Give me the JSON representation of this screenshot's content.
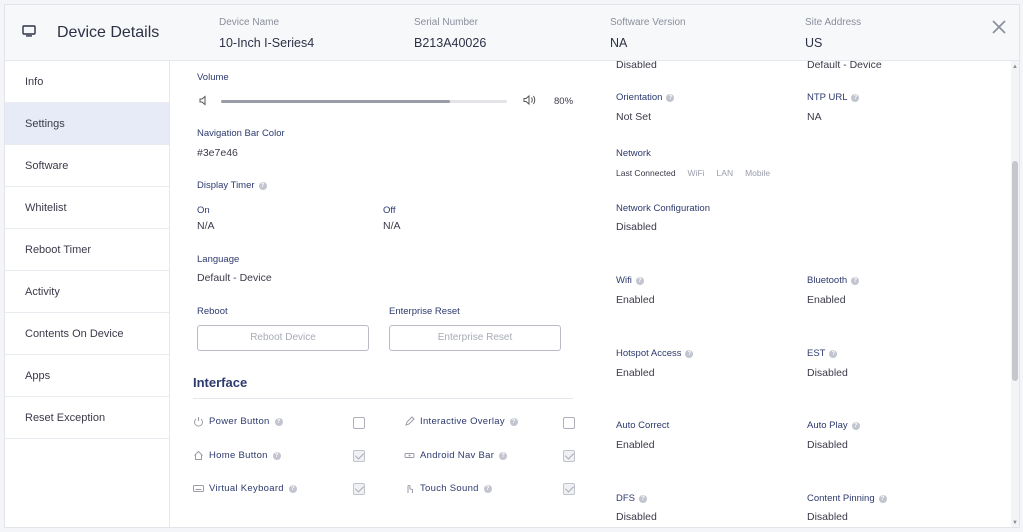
{
  "header": {
    "title": "Device Details",
    "fields": [
      {
        "label": "Device Name",
        "value": "10-Inch I-Series4"
      },
      {
        "label": "Serial Number",
        "value": "B213A40026"
      },
      {
        "label": "Software Version",
        "value": "NA"
      },
      {
        "label": "Site Address",
        "value": "US"
      }
    ]
  },
  "sidebar": {
    "items": [
      {
        "label": "Info"
      },
      {
        "label": "Settings"
      },
      {
        "label": "Software"
      },
      {
        "label": "Whitelist"
      },
      {
        "label": "Reboot Timer"
      },
      {
        "label": "Activity"
      },
      {
        "label": "Contents On Device"
      },
      {
        "label": "Apps"
      },
      {
        "label": "Reset Exception"
      }
    ],
    "active_index": 1
  },
  "settings": {
    "volume": {
      "label": "Volume",
      "value_text": "80%",
      "level": 0.8
    },
    "nav_bar_color": {
      "label": "Navigation Bar Color",
      "value": "#3e7e46"
    },
    "display_timer": {
      "label": "Display Timer",
      "on_label": "On",
      "on_value": "N/A",
      "off_label": "Off",
      "off_value": "N/A"
    },
    "language": {
      "label": "Language",
      "value": "Default - Device"
    },
    "reboot": {
      "label": "Reboot",
      "button": "Reboot Device"
    },
    "enterprise_reset": {
      "label": "Enterprise Reset",
      "button": "Enterprise Reset"
    },
    "top_cut_left": "Disabled",
    "top_cut_right": "Default - Device",
    "orientation": {
      "label": "Orientation",
      "value": "Not Set"
    },
    "ntp_url": {
      "label": "NTP URL",
      "value": "NA"
    },
    "network": {
      "label": "Network",
      "tabs": [
        "Last Connected",
        "WiFi",
        "LAN",
        "Mobile"
      ]
    },
    "network_config": {
      "label": "Network Configuration",
      "value": "Disabled"
    },
    "wifi": {
      "label": "Wifi",
      "value": "Enabled"
    },
    "bluetooth": {
      "label": "Bluetooth",
      "value": "Enabled"
    },
    "hotspot": {
      "label": "Hotspot Access",
      "value": "Enabled"
    },
    "est": {
      "label": "EST",
      "value": "Disabled"
    },
    "auto_correct": {
      "label": "Auto Correct",
      "value": "Enabled"
    },
    "auto_play": {
      "label": "Auto Play",
      "value": "Disabled"
    },
    "dfs": {
      "label": "DFS",
      "value": "Disabled"
    },
    "content_pinning": {
      "label": "Content Pinning",
      "value": "Disabled"
    }
  },
  "interface": {
    "title": "Interface",
    "items": [
      {
        "label": "Power Button",
        "icon": "power-icon",
        "checked": false
      },
      {
        "label": "Interactive Overlay",
        "icon": "pencil-icon",
        "checked": false
      },
      {
        "label": "Home Button",
        "icon": "home-icon",
        "checked": true
      },
      {
        "label": "Android Nav Bar",
        "icon": "nav-bar-icon",
        "checked": true
      },
      {
        "label": "Virtual Keyboard",
        "icon": "keyboard-icon",
        "checked": true
      },
      {
        "label": "Touch Sound",
        "icon": "touch-icon",
        "checked": true
      }
    ]
  },
  "colors": {
    "accent": "#2d3a6e",
    "active_bg": "#e6ebf7"
  }
}
